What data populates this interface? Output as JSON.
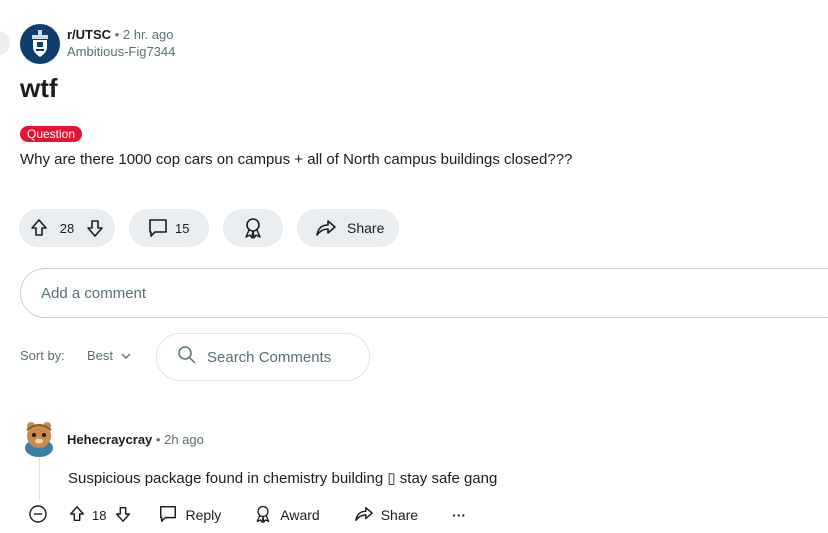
{
  "post": {
    "subreddit": "r/UTSC",
    "separator": "•",
    "time": "2 hr. ago",
    "author": "Ambitious-Fig7344",
    "title": "wtf",
    "flair": "Question",
    "body": "Why are there 1000 cop cars on campus + all of North campus buildings closed???",
    "votes": "28",
    "comments": "15",
    "share_label": "Share"
  },
  "comment_input": {
    "placeholder": "Add a comment"
  },
  "sort": {
    "label": "Sort by:",
    "value": "Best"
  },
  "search": {
    "placeholder": "Search Comments"
  },
  "comment": {
    "author": "Hehecraycray",
    "separator": "•",
    "time": "2h ago",
    "text": "Suspicious package found in chemistry building ▯ stay safe gang",
    "votes": "18",
    "reply_label": "Reply",
    "award_label": "Award",
    "share_label": "Share",
    "more_label": "···"
  },
  "colors": {
    "flair_bg": "#e41331",
    "pill_bg": "#eaedef",
    "avatar_bg": "#0e3d6e"
  },
  "icons": [
    "upvote-icon",
    "downvote-icon",
    "comment-icon",
    "award-icon",
    "share-icon",
    "search-icon",
    "chevron-down-icon",
    "collapse-icon",
    "reply-icon",
    "more-icon"
  ]
}
